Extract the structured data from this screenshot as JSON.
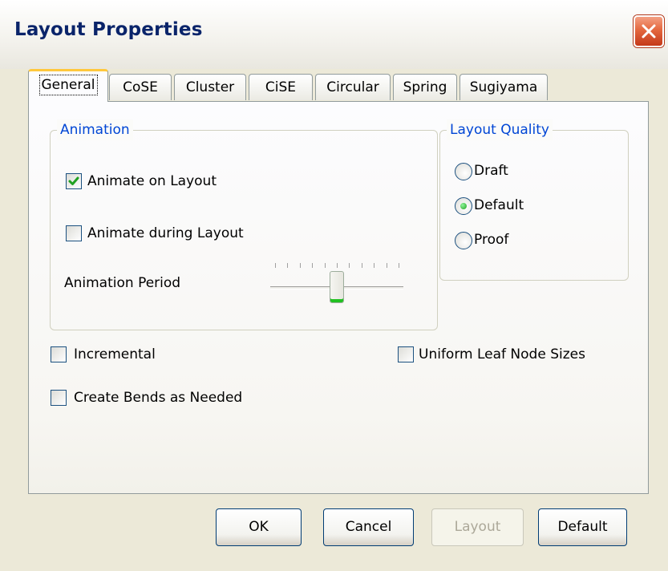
{
  "window": {
    "title": "Layout Properties"
  },
  "tabs": [
    {
      "label": "General",
      "active": true
    },
    {
      "label": "CoSE"
    },
    {
      "label": "Cluster"
    },
    {
      "label": "CiSE"
    },
    {
      "label": "Circular"
    },
    {
      "label": "Spring"
    },
    {
      "label": "Sugiyama"
    }
  ],
  "animation": {
    "legend": "Animation",
    "animate_on_layout": {
      "label": "Animate on Layout",
      "checked": true
    },
    "animate_during_layout": {
      "label": "Animate during Layout",
      "checked": false
    },
    "period": {
      "label": "Animation Period",
      "value_fraction": 0.5,
      "ticks": 11
    }
  },
  "quality": {
    "legend": "Layout Quality",
    "options": [
      {
        "label": "Draft",
        "selected": false
      },
      {
        "label": "Default",
        "selected": true
      },
      {
        "label": "Proof",
        "selected": false
      }
    ]
  },
  "options": {
    "incremental": {
      "label": "Incremental",
      "checked": false
    },
    "create_bends": {
      "label": "Create Bends as Needed",
      "checked": false
    },
    "uniform_leaf": {
      "label": "Uniform Leaf Node Sizes",
      "checked": false
    }
  },
  "buttons": {
    "ok": "OK",
    "cancel": "Cancel",
    "layout": "Layout",
    "default": "Default"
  },
  "colors": {
    "legend_text": "#0046d5",
    "title_text": "#0a246a",
    "close_button": "#e4683f",
    "active_tab_accent": "#ffc83c"
  },
  "icons": {
    "close": "close-icon",
    "check": "checkmark-icon",
    "radio_selected": "radio-dot-icon"
  }
}
